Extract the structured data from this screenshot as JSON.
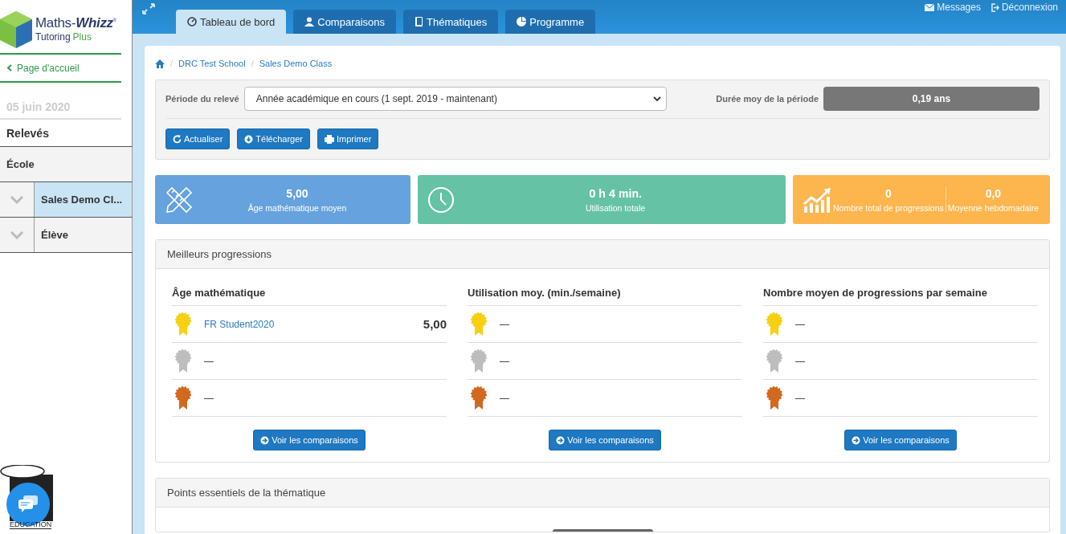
{
  "logo": {
    "title": "Maths-**Whizz**$^{®}$",
    "subtitle": "Tutoring",
    "subtitle_accent": "Plus"
  },
  "sidebar": {
    "home_link": "Page d'accueil",
    "date": "05 juin 2020",
    "section": "Relevés",
    "items": [
      {
        "label": "École",
        "kind": "leaf",
        "selected": false
      },
      {
        "label": "Sales Demo Cl...",
        "kind": "branch",
        "selected": true
      },
      {
        "label": "Élève",
        "kind": "branch",
        "selected": false
      }
    ],
    "footer_logo": "EDUCATION"
  },
  "tabs": [
    {
      "label": "Tableau de bord",
      "selected": true
    },
    {
      "label": "Comparaisons",
      "selected": false
    },
    {
      "label": "Thématiques",
      "selected": false
    },
    {
      "label": "Programme",
      "selected": false
    }
  ],
  "top_links": [
    "Messages",
    "Déconnexion"
  ],
  "breadcrumb": [
    {
      "separator": "/",
      "label": "DRC Test School"
    },
    {
      "separator": "/",
      "label": "Sales Demo Class"
    }
  ],
  "filters": {
    "period_label": "Période du relevé",
    "period_value": "Année académique en cours (1 sept. 2019 - maintenant)",
    "duration_label": "Durée moy de la période",
    "duration_value": "0,19 ans",
    "buttons": [
      "Actualiser",
      "Télécharger",
      "Imprimer"
    ]
  },
  "stat_cards": [
    {
      "color": "#66a2dd",
      "stats": [
        {
          "value": "5,00",
          "label": "Âge mathématique moyen"
        }
      ]
    },
    {
      "color": "#66c2a5",
      "stats": [
        {
          "value": "**0** h **4** min.",
          "label": "Utilisation totale"
        }
      ]
    },
    {
      "color": "#fdb54d",
      "stats": [
        {
          "value": "0",
          "label": "Nombre total de progressions"
        },
        {
          "value": "0,0",
          "label": "Moyenne hebdomadaire"
        }
      ]
    }
  ],
  "best_progress": {
    "title": "Meilleurs progressions",
    "columns": [
      {
        "heading": "Âge mathématique",
        "rows": [
          {
            "kind": "gold",
            "name": "FR Student2020",
            "value": "5,00"
          },
          {
            "kind": "silver",
            "text": "—"
          },
          {
            "kind": "bronze",
            "text": "—"
          }
        ],
        "button": "Voir les comparaisons"
      },
      {
        "heading": "Utilisation moy. (min./semaine)",
        "rows": [
          {
            "kind": "gold",
            "text": "—"
          },
          {
            "kind": "silver",
            "text": "—"
          },
          {
            "kind": "bronze",
            "text": "—"
          }
        ],
        "button": "Voir les comparaisons"
      },
      {
        "heading": "Nombre moyen de progressions par semaine",
        "rows": [
          {
            "kind": "gold",
            "text": "—"
          },
          {
            "kind": "silver",
            "text": "—"
          },
          {
            "kind": "bronze",
            "text": "—"
          }
        ],
        "button": "Voir les comparaisons"
      }
    ]
  },
  "topic_panel": {
    "title": "Points essentiels de la thématique"
  }
}
